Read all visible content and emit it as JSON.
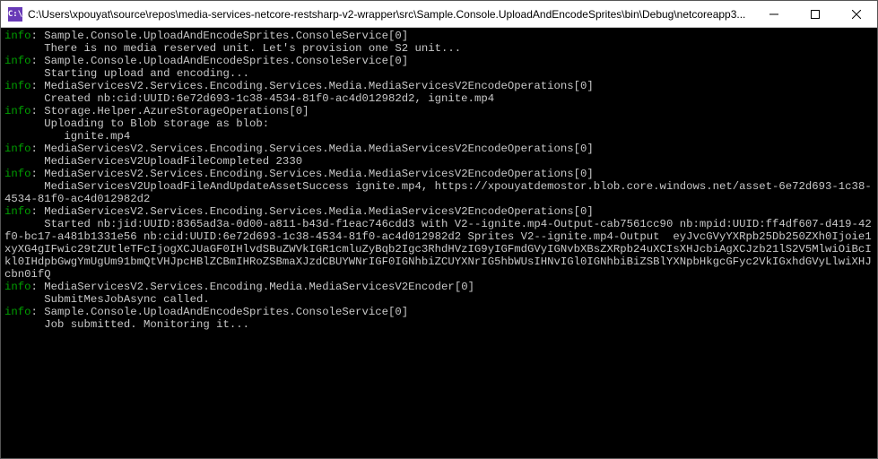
{
  "titlebar": {
    "icon_letters": "C:\\",
    "path": "C:\\Users\\xpouyat\\source\\repos\\media-services-netcore-restsharp-v2-wrapper\\src\\Sample.Console.UploadAndEncodeSprites\\bin\\Debug\\netcoreapp3...",
    "minimize_glyph": "—",
    "maximize_glyph": "☐",
    "close_glyph": "✕"
  },
  "log": {
    "label_info": "info",
    "lines": [
      {
        "lvl": "info",
        "src": "Sample.Console.UploadAndEncodeSprites.ConsoleService[0]",
        "msg": "There is no media reserved unit. Let's provision one S2 unit..."
      },
      {
        "lvl": "info",
        "src": "Sample.Console.UploadAndEncodeSprites.ConsoleService[0]",
        "msg": "Starting upload and encoding..."
      },
      {
        "lvl": "info",
        "src": "MediaServicesV2.Services.Encoding.Services.Media.MediaServicesV2EncodeOperations[0]",
        "msg": "Created nb:cid:UUID:6e72d693-1c38-4534-81f0-ac4d012982d2, ignite.mp4"
      },
      {
        "lvl": "info",
        "src": "Storage.Helper.AzureStorageOperations[0]",
        "msg": "Uploading to Blob storage as blob:\n         ignite.mp4\n"
      },
      {
        "lvl": "info",
        "src": "MediaServicesV2.Services.Encoding.Services.Media.MediaServicesV2EncodeOperations[0]",
        "msg": "MediaServicesV2UploadFileCompleted 2330"
      },
      {
        "lvl": "info",
        "src": "MediaServicesV2.Services.Encoding.Services.Media.MediaServicesV2EncodeOperations[0]",
        "msg": "MediaServicesV2UploadFileAndUpdateAssetSuccess ignite.mp4, https://xpouyatdemostor.blob.core.windows.net/asset-6e72d693-1c38-4534-81f0-ac4d012982d2"
      },
      {
        "lvl": "info",
        "src": "MediaServicesV2.Services.Encoding.Services.Media.MediaServicesV2EncodeOperations[0]",
        "msg": "Started nb:jid:UUID:8365ad3a-0d00-a811-b43d-f1eac746cdd3 with V2--ignite.mp4-Output-cab7561cc90 nb:mpid:UUID:ff4df607-d419-42f0-bc17-a481b1331e56 nb:cid:UUID:6e72d693-1c38-4534-81f0-ac4d012982d2 Sprites V2--ignite.mp4-Output  eyJvcGVyYXRpb25Db250ZXh0Ijoie1xyXG4gIFwic29tZUtleTFcIjogXCJUaGF0IHlvdSBuZWVkIGR1cmluZyBqb2Igc3RhdHVzIG9yIGFmdGVyIGNvbXBsZXRpb24uXCIsXHJcbiAgXCJzb21lS2V5MlwiOiBcIkl0IHdpbGwgYmUgUm91bmQtVHJpcHBlZCBmIHRoZSBmaXJzdCBUYWNrIGF0IGNhbiZCUYXNrIG5hbWUsIHNvIGl0IGNhbiBiZSBlYXNpbHkgcGFyc2VkIGxhdGVyLlwiXHJcbn0ifQ"
      },
      {
        "lvl": "info",
        "src": "MediaServicesV2.Services.Encoding.Media.MediaServicesV2Encoder[0]",
        "msg": "SubmitMesJobAsync called."
      },
      {
        "lvl": "info",
        "src": "Sample.Console.UploadAndEncodeSprites.ConsoleService[0]",
        "msg": "Job submitted. Monitoring it..."
      }
    ]
  }
}
